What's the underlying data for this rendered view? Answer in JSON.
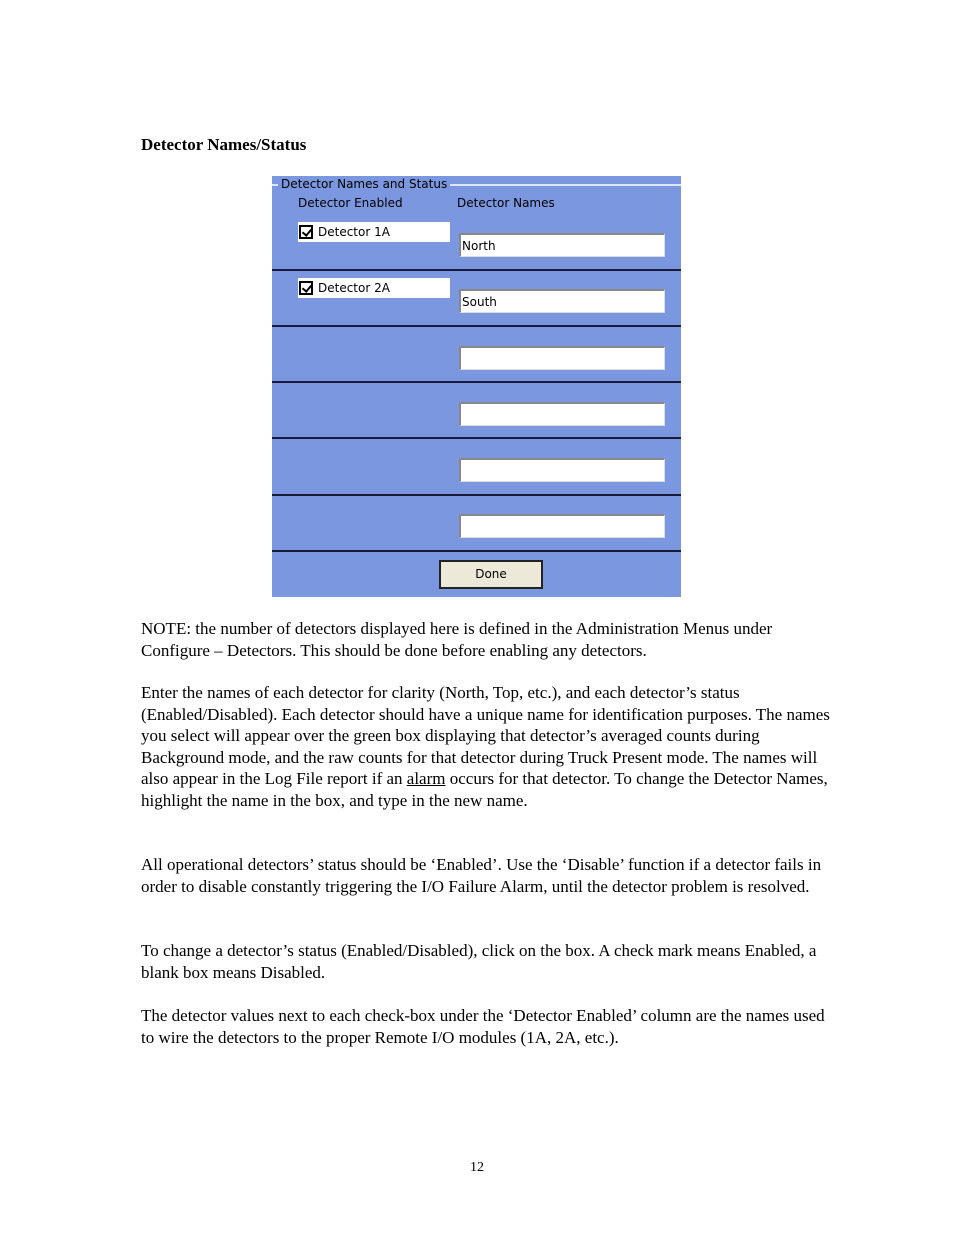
{
  "heading": "Detector Names/Status",
  "dialog": {
    "group_title": "Detector Names and Status",
    "col_enabled": "Detector Enabled",
    "col_names": "Detector Names",
    "bg_color": "#7b97df",
    "rows": [
      {
        "label": "Detector 1A",
        "checked": true,
        "name": "North"
      },
      {
        "label": "Detector 2A",
        "checked": true,
        "name": "South"
      },
      {
        "name": ""
      },
      {
        "name": ""
      },
      {
        "name": ""
      },
      {
        "name": ""
      }
    ],
    "done": "Done"
  },
  "paragraphs": {
    "p1": "NOTE: the number of detectors displayed here is defined in the Administration Menus under Configure – Detectors.  This should be done before enabling any detectors.",
    "p2a": "Enter the names of each detector for clarity (North, Top, etc.), and each detector’s status (Enabled/Disabled).  Each detector should have a unique name for identification purposes. The names you select will appear over the green box displaying that detector’s averaged counts during Background mode, and the raw counts for that detector during Truck Present mode.  The names will also appear in the Log File report if an ",
    "p2link": "alarm",
    "p2b": " occurs for that detector. To change the Detector Names, highlight the name in the box, and type in the new name.",
    "p3": "All operational detectors’ status should be ‘Enabled’.  Use the ‘Disable’ function if a detector fails in order to disable constantly triggering the I/O Failure Alarm, until the detector problem is resolved.",
    "p4": "To change a detector’s status (Enabled/Disabled), click on the box.  A check mark means Enabled, a blank box means Disabled.",
    "p5": "The detector values next to each check-box under the ‘Detector Enabled’ column are the names used to wire the detectors to the proper Remote I/O modules (1A, 2A, etc.)."
  },
  "page_number": "12"
}
